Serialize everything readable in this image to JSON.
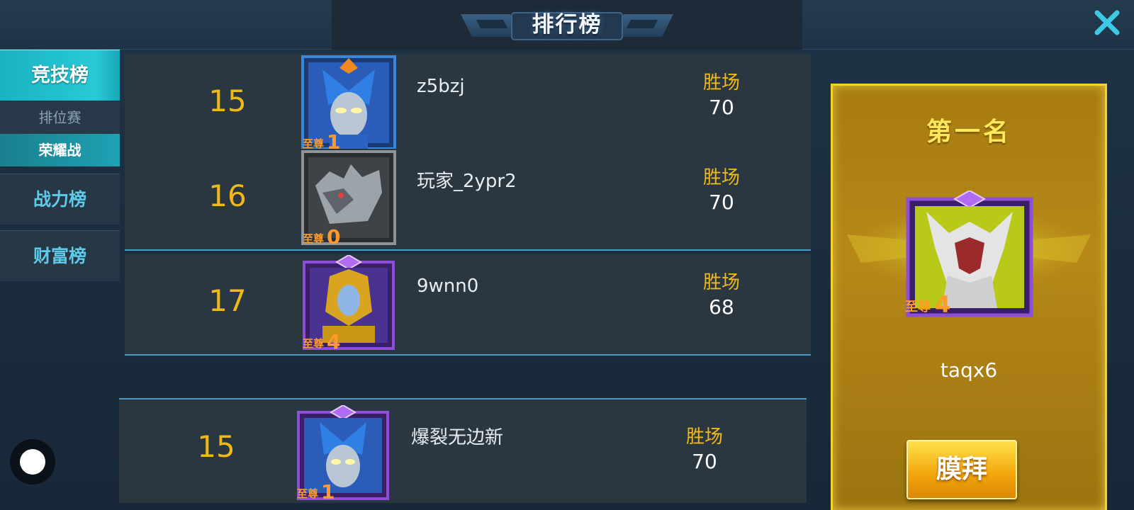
{
  "header": {
    "title": "排行榜"
  },
  "nav": {
    "main_label": "竞技榜",
    "sub_items": [
      "排位赛",
      "荣耀战"
    ],
    "other_items": [
      "战力榜",
      "财富榜"
    ]
  },
  "rankings": [
    {
      "rank": "15",
      "name": "z5bzj",
      "wins_label": "胜场",
      "wins": "70",
      "badge_label": "至尊",
      "badge_level": "1",
      "avatar_icon": "blue-armor-hero-portrait",
      "frame": "blue"
    },
    {
      "rank": "16",
      "name": "玩家_2ypr2",
      "wins_label": "胜场",
      "wins": "70",
      "badge_label": "至尊",
      "badge_level": "0",
      "avatar_icon": "silver-monster-portrait",
      "frame": "gray"
    },
    {
      "rank": "17",
      "name": "9wnn0",
      "wins_label": "胜场",
      "wins": "68",
      "badge_label": "至尊",
      "badge_level": "4",
      "avatar_icon": "gold-armor-hero-portrait",
      "frame": "purple"
    }
  ],
  "my_rank": {
    "rank": "15",
    "name": "爆裂无边新",
    "wins_label": "胜场",
    "wins": "70",
    "badge_label": "至尊",
    "badge_level": "1",
    "avatar_icon": "blue-armor-hero-portrait",
    "frame": "purple"
  },
  "first_place": {
    "title": "第一名",
    "name": "taqx6",
    "badge_label": "至尊",
    "badge_level": "4",
    "avatar_icon": "white-horned-monster-portrait",
    "button_label": "膜拜"
  },
  "colors": {
    "rank_gold": "#f0b91a",
    "nav_active": "#1ab3c4",
    "panel_gold": "#f3d22b"
  }
}
